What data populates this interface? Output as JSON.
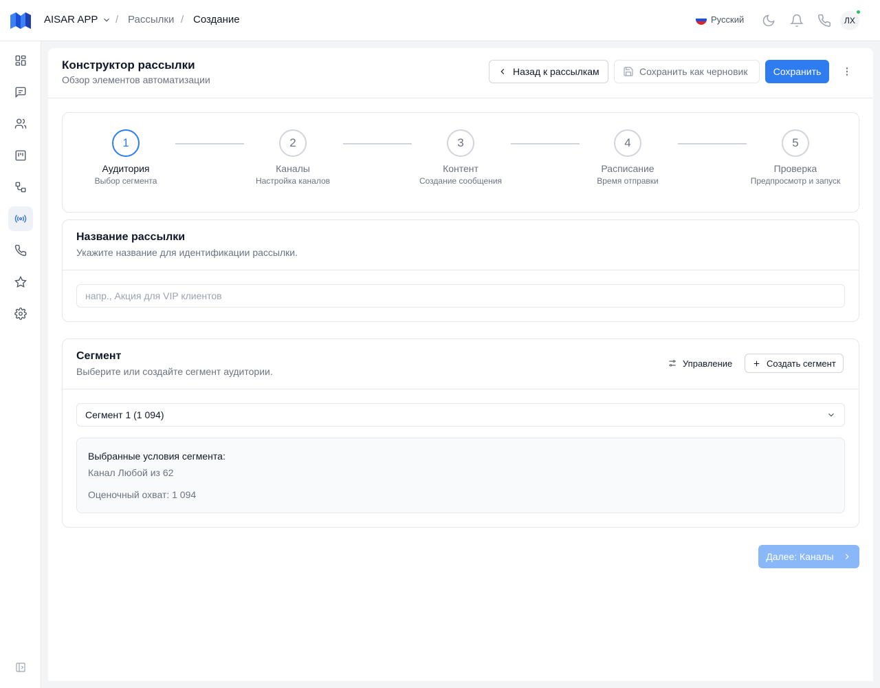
{
  "topbar": {
    "app_name": "AISAR APP",
    "breadcrumbs": [
      "Рассылки",
      "Создание"
    ],
    "language": "Русский",
    "avatar_initials": "ЛХ"
  },
  "sidebar": {
    "items": [
      {
        "icon": "dashboard-icon"
      },
      {
        "icon": "messages-icon"
      },
      {
        "icon": "contacts-icon"
      },
      {
        "icon": "board-icon"
      },
      {
        "icon": "flow-icon"
      },
      {
        "icon": "broadcast-icon",
        "active": true
      },
      {
        "icon": "phone-icon"
      },
      {
        "icon": "star-icon"
      },
      {
        "icon": "settings-icon"
      }
    ],
    "collapse_icon": "sidebar-collapse-icon"
  },
  "header": {
    "title": "Конструктор рассылки",
    "subtitle": "Обзор элементов автоматизации",
    "back_label": "Назад к рассылкам",
    "draft_label": "Сохранить как черновик",
    "save_label": "Сохранить"
  },
  "stepper": {
    "steps": [
      {
        "num": "1",
        "title": "Аудитория",
        "sub": "Выбор сегмента",
        "active": true
      },
      {
        "num": "2",
        "title": "Каналы",
        "sub": "Настройка каналов"
      },
      {
        "num": "3",
        "title": "Контент",
        "sub": "Создание сообщения"
      },
      {
        "num": "4",
        "title": "Расписание",
        "sub": "Время отправки"
      },
      {
        "num": "5",
        "title": "Проверка",
        "sub": "Предпросмотр и запуск"
      }
    ]
  },
  "name_section": {
    "title": "Название рассылки",
    "subtitle": "Укажите название для идентификации рассылки.",
    "placeholder": "напр., Акция для VIP клиентов"
  },
  "segment_section": {
    "title": "Сегмент",
    "subtitle": "Выберите или создайте сегмент аудитории.",
    "manage_label": "Управление",
    "create_label": "Создать сегмент",
    "selected": "Сегмент 1 (1 094)",
    "conditions_title": "Выбранные условия сегмента:",
    "condition": "Канал Любой из 62",
    "reach": "Оценочный охват: 1 094"
  },
  "footer": {
    "next_label": "Далее: Каналы"
  },
  "colors": {
    "primary": "#2f7bf0",
    "primary_disabled": "#8ab7f7",
    "online": "#22c55e"
  }
}
